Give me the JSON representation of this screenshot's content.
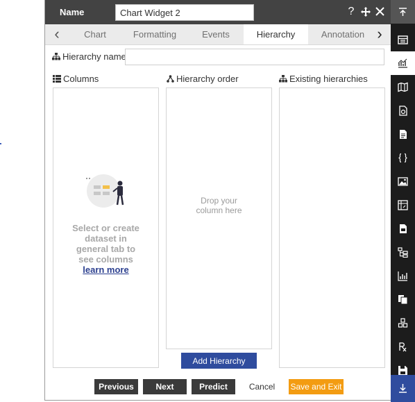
{
  "header": {
    "name_label": "Name",
    "widget_name": "Chart Widget 2"
  },
  "tabs": [
    {
      "label": "Chart"
    },
    {
      "label": "Formatting"
    },
    {
      "label": "Events"
    },
    {
      "label": "Hierarchy"
    },
    {
      "label": "Annotation"
    }
  ],
  "active_tab": "Hierarchy",
  "hierarchy": {
    "name_label": "Hierarchy name",
    "name_value": ""
  },
  "columns": {
    "label": "Columns",
    "empty_message": "Select or create dataset in general tab to see columns",
    "learn_more": "learn more"
  },
  "hierarchy_order": {
    "label": "Hierarchy order",
    "drop_text": "Drop your column here"
  },
  "existing": {
    "label": "Existing hierarchies"
  },
  "add_button": "Add Hierarchy",
  "footer": {
    "previous": "Previous",
    "next": "Next",
    "predict": "Predict",
    "cancel": "Cancel",
    "save_exit": "Save and Exit"
  },
  "rail_icons": [
    "collapse-top-icon",
    "table-icon",
    "chart-icon",
    "map-icon",
    "report-icon",
    "document-icon",
    "code-braces-icon",
    "image-icon",
    "pivot-icon",
    "text-report-icon",
    "hierarchy-icon",
    "bar-chart-icon",
    "copy-icon",
    "cubes-icon",
    "formula-icon",
    "save-icon",
    "collapse-bottom-icon"
  ],
  "colors": {
    "header": "#434343",
    "accent": "#2f4c9e",
    "save": "#f39c12",
    "rail": "#1c1c1c"
  }
}
